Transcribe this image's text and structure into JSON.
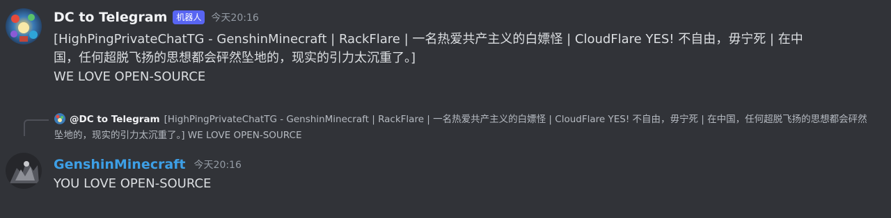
{
  "messages": [
    {
      "author": "DC to Telegram",
      "bot_tag": "机器人",
      "timestamp": "今天20:16",
      "lines": [
        "[HighPingPrivateChatTG - GenshinMinecraft | RackFlare | 一名热爱共产主义的白嫖怪 | CloudFlare YES! 不自由，毋宁死 | 在中",
        "国，任何超脱飞扬的思想都会砰然坠地的，现实的引力太沉重了。]",
        "WE LOVE OPEN-SOURCE"
      ]
    },
    {
      "author": "GenshinMinecraft",
      "timestamp": "今天20:16",
      "reply": {
        "author": "@DC to Telegram",
        "text": "[HighPingPrivateChatTG - GenshinMinecraft | RackFlare | 一名热爱共产主义的白嫖怪 | CloudFlare YES! 不自由，毋宁死 | 在中国，任何超脱飞扬的思想都会砰然坠地的，现实的引力太沉重了。] WE LOVE OPEN-SOURCE"
      },
      "lines": [
        "YOU LOVE OPEN-SOURCE"
      ]
    }
  ],
  "colors": {
    "background": "#313338",
    "bot_tag": "#5865f2",
    "username_default": "#f2f3f5",
    "username_genshin": "#3d9fe6",
    "timestamp": "#949ba4",
    "text": "#dbdee1"
  }
}
